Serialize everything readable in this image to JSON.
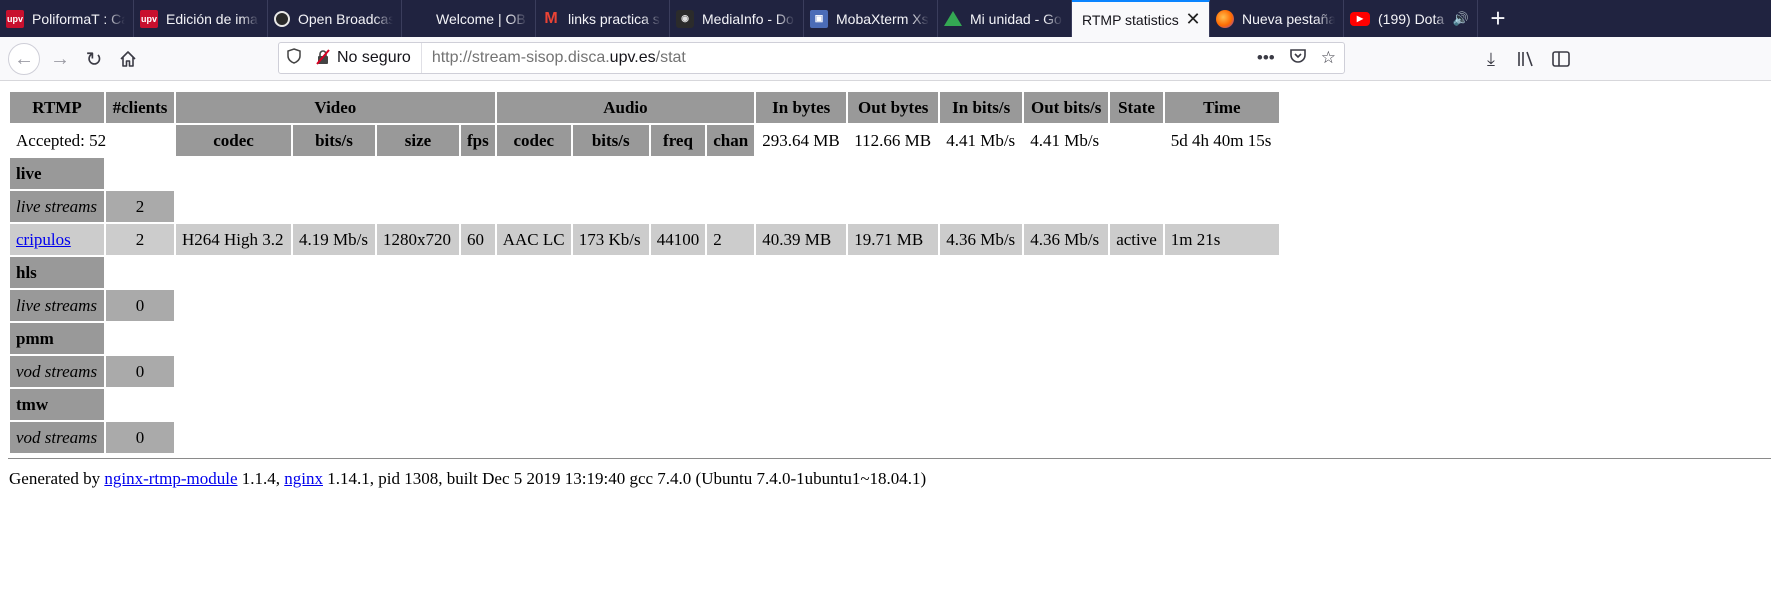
{
  "browser": {
    "tabs": [
      {
        "label": "PoliformaT : Ca",
        "icon": "upv-favicon"
      },
      {
        "label": "Edición de ima",
        "icon": "upv-favicon"
      },
      {
        "label": "Open Broadcas",
        "icon": "obs-favicon"
      },
      {
        "label": "Welcome | OBS",
        "icon": "none"
      },
      {
        "label": "links practica s",
        "icon": "gmail-favicon"
      },
      {
        "label": "MediaInfo - Do",
        "icon": "mediainfo-favicon"
      },
      {
        "label": "MobaXterm Xs",
        "icon": "mobaxterm-favicon"
      },
      {
        "label": "Mi unidad - Go",
        "icon": "drive-favicon"
      },
      {
        "label": "RTMP statistics",
        "icon": "none",
        "active": true
      },
      {
        "label": "Nueva pestaña",
        "icon": "firefox-favicon"
      },
      {
        "label": "(199) Dota",
        "icon": "youtube-favicon",
        "audio": true
      }
    ],
    "new_tab": "+",
    "close_tab": "✕",
    "urlbar": {
      "security_label": "No seguro",
      "url_prefix": "http://stream-sisop.disca.",
      "url_domain": "upv.es",
      "url_suffix": "/stat"
    },
    "accent": "#0a84ff"
  },
  "stats": {
    "headers": {
      "rtmp": "RTMP",
      "clients": "#clients",
      "video": "Video",
      "audio": "Audio",
      "in_bytes": "In bytes",
      "out_bytes": "Out bytes",
      "in_bits": "In bits/s",
      "out_bits": "Out bits/s",
      "state": "State",
      "time": "Time",
      "v_codec": "codec",
      "v_bits": "bits/s",
      "v_size": "size",
      "v_fps": "fps",
      "a_codec": "codec",
      "a_bits": "bits/s",
      "a_freq": "freq",
      "a_chan": "chan"
    },
    "summary": {
      "accepted": "Accepted: 52",
      "in_bytes": "293.64 MB",
      "out_bytes": "112.66 MB",
      "in_bits": "4.41 Mb/s",
      "out_bits": "4.41 Mb/s",
      "time": "5d 4h 40m 15s"
    },
    "apps": [
      {
        "name": "live",
        "kind": "live streams",
        "count": "2"
      },
      {
        "name": "hls",
        "kind": "live streams",
        "count": "0"
      },
      {
        "name": "pmm",
        "kind": "vod streams",
        "count": "0"
      },
      {
        "name": "tmw",
        "kind": "vod streams",
        "count": "0"
      }
    ],
    "stream": {
      "name": "cripulos",
      "clients": "2",
      "v_codec": "H264 High 3.2",
      "v_bits": "4.19 Mb/s",
      "v_size": "1280x720",
      "v_fps": "60",
      "a_codec": "AAC LC",
      "a_bits": "173 Kb/s",
      "a_freq": "44100",
      "a_chan": "2",
      "in_bytes": "40.39 MB",
      "out_bytes": "19.71 MB",
      "in_bits": "4.36 Mb/s",
      "out_bits": "4.36 Mb/s",
      "state": "active",
      "time": "1m 21s"
    }
  },
  "footer": {
    "generated_by": "Generated by",
    "module_link": "nginx-rtmp-module",
    "module_version": "1.1.4,",
    "nginx_link": "nginx",
    "rest": "1.14.1, pid 1308, built Dec 5 2019 13:19:40 gcc 7.4.0 (Ubuntu 7.4.0-1ubuntu1~18.04.1)"
  }
}
